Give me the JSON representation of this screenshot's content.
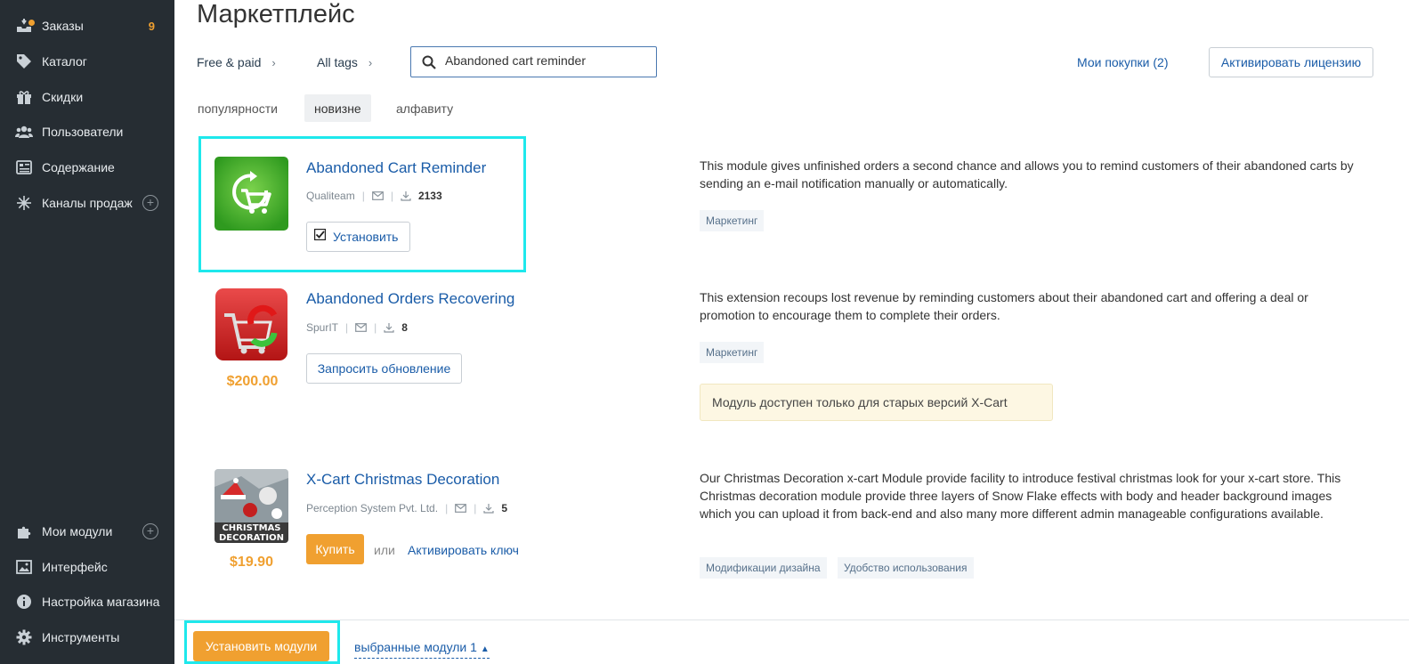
{
  "sidebar": {
    "items": [
      {
        "label": "Заказы",
        "icon": "orders-icon",
        "badge": "9"
      },
      {
        "label": "Каталог",
        "icon": "tag-icon"
      },
      {
        "label": "Скидки",
        "icon": "gift-icon"
      },
      {
        "label": "Пользователи",
        "icon": "users-icon"
      },
      {
        "label": "Содержание",
        "icon": "content-icon"
      },
      {
        "label": "Каналы продаж",
        "icon": "channels-icon",
        "plus": "+"
      },
      {
        "label": "Мои модули",
        "icon": "puzzle-icon",
        "plus": "+"
      },
      {
        "label": "Интерфейс",
        "icon": "image-icon"
      },
      {
        "label": "Настройка магазина",
        "icon": "info-icon"
      },
      {
        "label": "Инструменты",
        "icon": "gear-icon"
      }
    ]
  },
  "header": {
    "title": "Маркетплейс",
    "filter_price": "Free & paid",
    "filter_tags": "All tags",
    "search_value": "Abandoned cart reminder",
    "my_purchases": "Мои покупки (2)",
    "activate_license": "Активировать лицензию"
  },
  "sort": {
    "popularity": "популярности",
    "newest": "новизне",
    "alphabet": "алфавиту",
    "active": "новизне"
  },
  "modules": [
    {
      "title": "Abandoned Cart Reminder",
      "vendor": "Qualiteam",
      "downloads": "2133",
      "action": "Установить",
      "checked": true,
      "description": "This module gives unfinished orders a second chance and allows you to remind customers of their abandoned carts by sending an e-mail notification manually or automatically.",
      "tags": [
        "Маркетинг"
      ]
    },
    {
      "title": "Abandoned Orders Recovering",
      "vendor": "SpurIT",
      "downloads": "8",
      "price": "$200.00",
      "action": "Запросить обновление",
      "description": "This extension recoups lost revenue by reminding customers about their abandoned cart and offering a deal or promotion to encourage them to complete their orders.",
      "tags": [
        "Маркетинг"
      ],
      "warning": "Модуль доступен только для старых версий X-Cart"
    },
    {
      "title": "X-Cart Christmas Decoration",
      "vendor": "Perception System Pvt. Ltd.",
      "downloads": "5",
      "price": "$19.90",
      "action": "Купить",
      "or_text": "или",
      "activate_key": "Активировать ключ",
      "thumb_caption": "CHRISTMAS DECORATION",
      "description": "Our Christmas Decoration x-cart Module provide facility to introduce festival christmas look for your x-cart store. This Christmas decoration module provide three layers of Snow Flake effects with body and header background images which you can upload it from back-end and also many more different admin manageable configurations available.",
      "tags": [
        "Модификации дизайна",
        "Удобство использования"
      ]
    }
  ],
  "footer": {
    "install_modules": "Установить модули",
    "selected_modules": "выбранные модули 1"
  },
  "colors": {
    "sidebar_bg": "#262d33",
    "accent_orange": "#f0a030",
    "link_blue": "#1a5ca8",
    "highlight_cyan": "#1ee8ec"
  }
}
